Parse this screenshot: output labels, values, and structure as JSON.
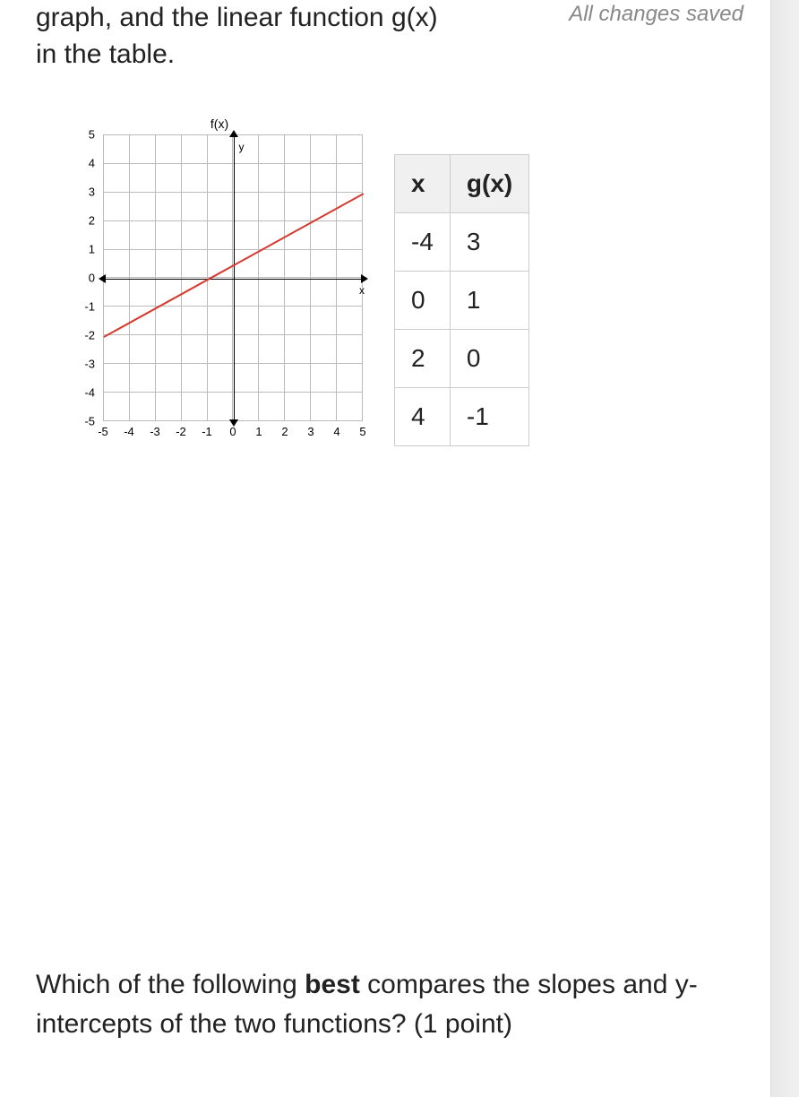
{
  "header": {
    "question_fragment_line1": "graph, and the linear function g(x)",
    "question_fragment_line2": "in the table.",
    "status": "All changes saved"
  },
  "chart_data": {
    "type": "line",
    "title": "f(x)",
    "xlabel": "x",
    "ylabel": "y",
    "xlim": [
      -5,
      5
    ],
    "ylim": [
      -5,
      5
    ],
    "x_ticks": [
      -5,
      -4,
      -3,
      -2,
      -1,
      0,
      1,
      2,
      3,
      4,
      5
    ],
    "y_ticks": [
      -5,
      -4,
      -3,
      -2,
      -1,
      0,
      1,
      2,
      3,
      4,
      5
    ],
    "series": [
      {
        "name": "f(x)",
        "color": "#d63a2f",
        "x": [
          -5,
          5
        ],
        "y": [
          -2,
          3
        ]
      }
    ],
    "slope_estimate": 0.5,
    "y_intercept_estimate": 0.5
  },
  "table": {
    "headers": {
      "col1": "x",
      "col2": "g(x)"
    },
    "rows": [
      {
        "x": "-4",
        "g": "3"
      },
      {
        "x": "0",
        "g": "1"
      },
      {
        "x": "2",
        "g": "0"
      },
      {
        "x": "4",
        "g": "-1"
      }
    ]
  },
  "footer_question": {
    "part1": "Which of the following ",
    "bold": "best",
    "part2": " compares the slopes and y-intercepts of the two functions? (1 point)"
  }
}
